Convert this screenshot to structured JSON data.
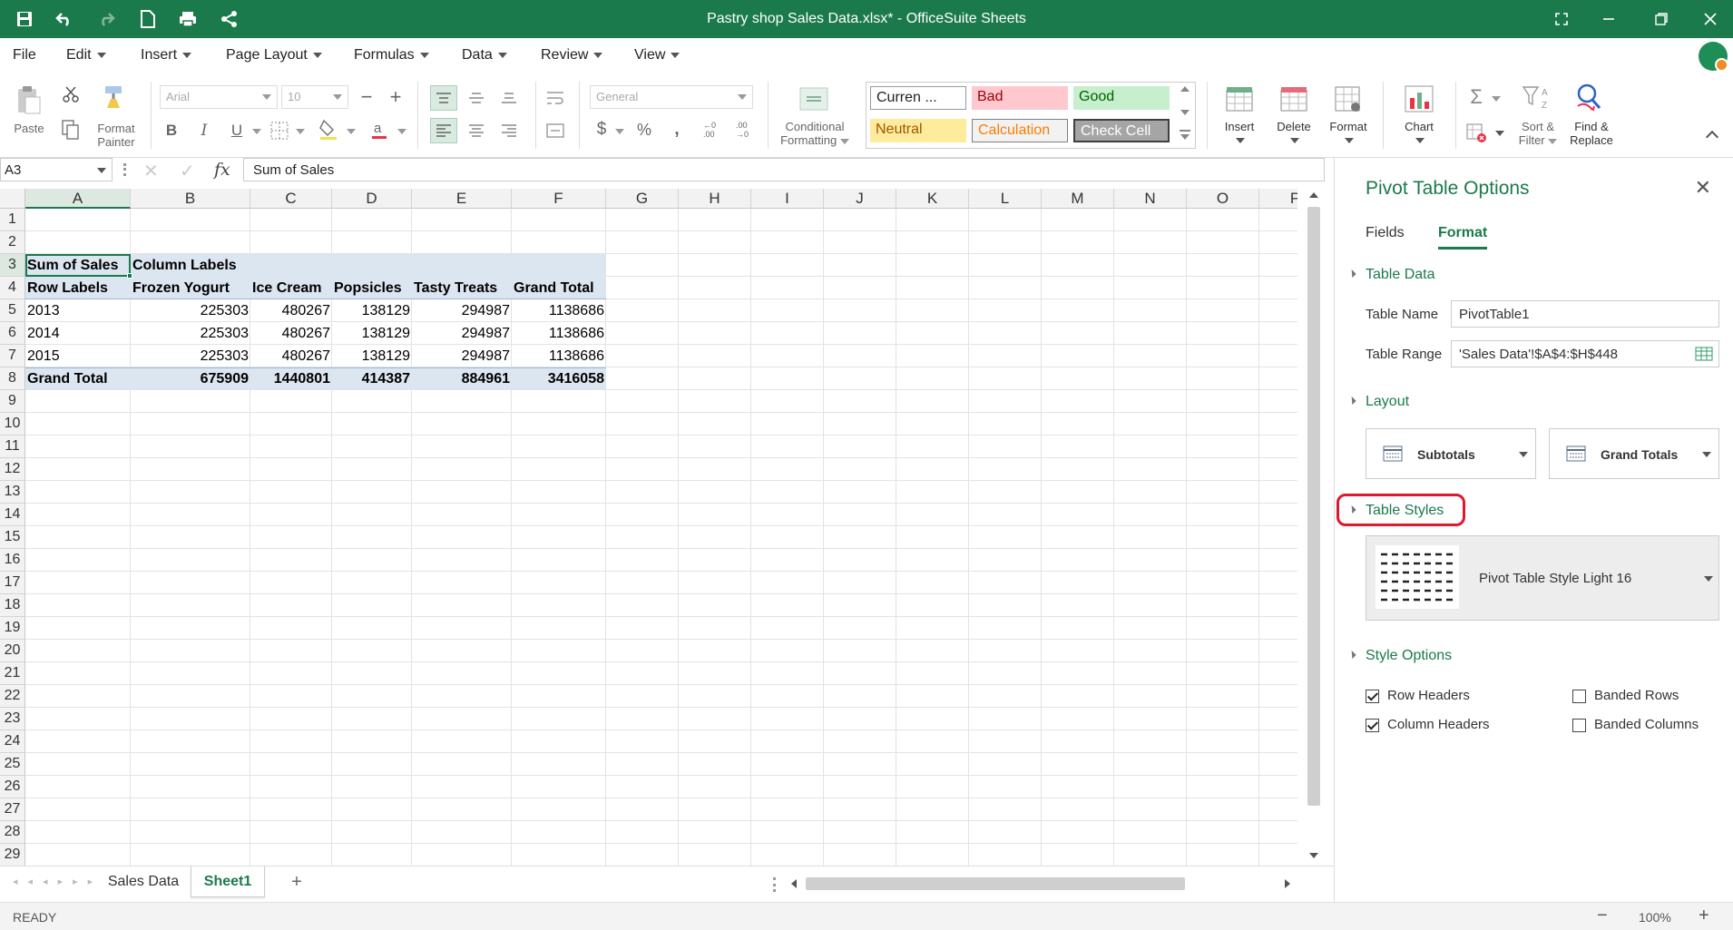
{
  "window": {
    "title": "Pastry shop Sales Data.xlsx* - OfficeSuite Sheets"
  },
  "menu": [
    "File",
    "Edit",
    "Insert",
    "Page Layout",
    "Formulas",
    "Data",
    "Review",
    "View"
  ],
  "ribbon": {
    "paste": "Paste",
    "format_painter": "Format Painter",
    "font_name": "Arial",
    "font_size": "10",
    "number_format": "General",
    "conditional_formatting": "Conditional Formatting",
    "cell_styles": {
      "curren": "Curren ...",
      "bad": "Bad",
      "good": "Good",
      "neutral": "Neutral",
      "calculation": "Calculation",
      "check_cell": "Check Cell"
    },
    "insert": "Insert",
    "delete": "Delete",
    "format": "Format",
    "chart": "Chart",
    "sort_filter": "Sort & Filter",
    "find_replace": "Find & Replace"
  },
  "formula_bar": {
    "cell_ref": "A3",
    "fx": "fx",
    "content": "Sum of Sales"
  },
  "columns": [
    "A",
    "B",
    "C",
    "D",
    "E",
    "F",
    "G",
    "H",
    "I",
    "J",
    "K",
    "L",
    "M",
    "N",
    "O",
    "P"
  ],
  "rows": [
    "1",
    "2",
    "3",
    "4",
    "5",
    "6",
    "7",
    "8",
    "9",
    "10",
    "11",
    "12",
    "13",
    "14",
    "15",
    "16",
    "17",
    "18",
    "19",
    "20",
    "21",
    "22",
    "23",
    "24",
    "25",
    "26",
    "27",
    "28",
    "29"
  ],
  "pivot": {
    "r3": {
      "a": "Sum of Sales",
      "b": "Column Labels"
    },
    "r4": [
      "Row Labels",
      "Frozen Yogurt",
      "Ice Cream",
      "Popsicles",
      "Tasty Treats",
      "Grand Total"
    ],
    "data": [
      [
        "2013",
        "225303",
        "480267",
        "138129",
        "294987",
        "1138686"
      ],
      [
        "2014",
        "225303",
        "480267",
        "138129",
        "294987",
        "1138686"
      ],
      [
        "2015",
        "225303",
        "480267",
        "138129",
        "294987",
        "1138686"
      ]
    ],
    "total": [
      "Grand Total",
      "675909",
      "1440801",
      "414387",
      "884961",
      "3416058"
    ]
  },
  "sheets": {
    "tab1": "Sales Data",
    "tab2": "Sheet1",
    "add": "+"
  },
  "status": {
    "state": "READY",
    "zoom": "100%",
    "minus": "−",
    "plus": "+"
  },
  "panel": {
    "title": "Pivot Table Options",
    "tab_fields": "Fields",
    "tab_format": "Format",
    "table_data": "Table Data",
    "table_name_label": "Table Name",
    "table_name": "PivotTable1",
    "table_range_label": "Table Range",
    "table_range": "'Sales Data'!$A$4:$H$448",
    "layout": "Layout",
    "subtotals": "Subtotals",
    "grand_totals": "Grand Totals",
    "table_styles": "Table Styles",
    "style_name": "Pivot Table Style Light 16",
    "style_options": "Style Options",
    "row_headers": "Row Headers",
    "column_headers": "Column Headers",
    "banded_rows": "Banded Rows",
    "banded_columns": "Banded Columns"
  },
  "colors": {
    "brand": "#1b7a4c",
    "pivot_header": "#dce6f1",
    "highlight": "#e0182d"
  }
}
